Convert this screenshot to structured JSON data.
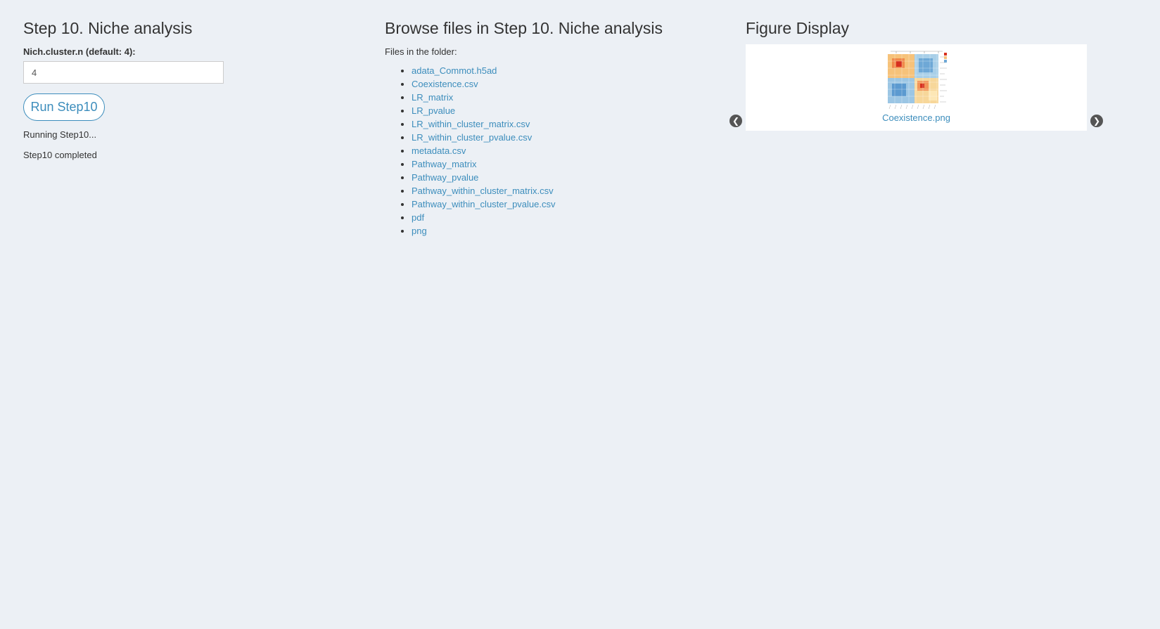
{
  "left_panel": {
    "title": "Step 10. Niche analysis",
    "input_label": "Nich.cluster.n (default: 4):",
    "input_value": "4",
    "run_button_label": "Run Step10",
    "status_lines": [
      "Running Step10...",
      "Step10 completed"
    ]
  },
  "middle_panel": {
    "title": "Browse files in Step 10. Niche analysis",
    "files_label": "Files in the folder:",
    "files": [
      "adata_Commot.h5ad",
      "Coexistence.csv",
      "LR_matrix",
      "LR_pvalue",
      "LR_within_cluster_matrix.csv",
      "LR_within_cluster_pvalue.csv",
      "metadata.csv",
      "Pathway_matrix",
      "Pathway_pvalue",
      "Pathway_within_cluster_matrix.csv",
      "Pathway_within_cluster_pvalue.csv",
      "pdf",
      "png"
    ]
  },
  "right_panel": {
    "title": "Figure Display",
    "figure_caption": "Coexistence.png",
    "prev_icon": "chevron-left-circle-icon",
    "next_icon": "chevron-right-circle-icon"
  },
  "colors": {
    "background": "#ecf0f5",
    "link": "#3c8dbc",
    "text": "#333333"
  }
}
